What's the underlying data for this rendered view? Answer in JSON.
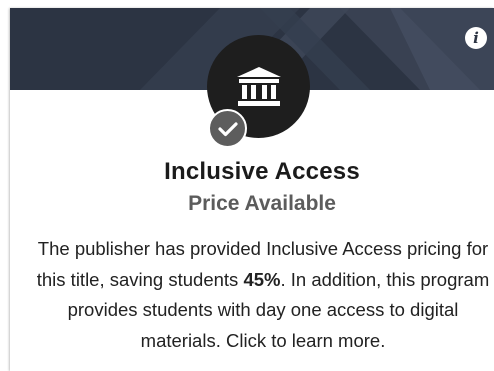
{
  "card": {
    "title": "Inclusive Access",
    "subtitle": "Price Available",
    "description_before": "The publisher has provided Inclusive Access pricing for this title, saving students ",
    "savings": "45%",
    "description_after": ". In addition, this program provides students with day one access to digital materials. Click to learn more.",
    "info_button_glyph": "i"
  },
  "icons": {
    "emblem": "institution-icon",
    "status": "checkmark-icon",
    "info": "info-icon"
  },
  "colors": {
    "banner": "#2c3443",
    "emblem_bg": "#1e1e1e",
    "check_bg": "#5d5d5d"
  }
}
